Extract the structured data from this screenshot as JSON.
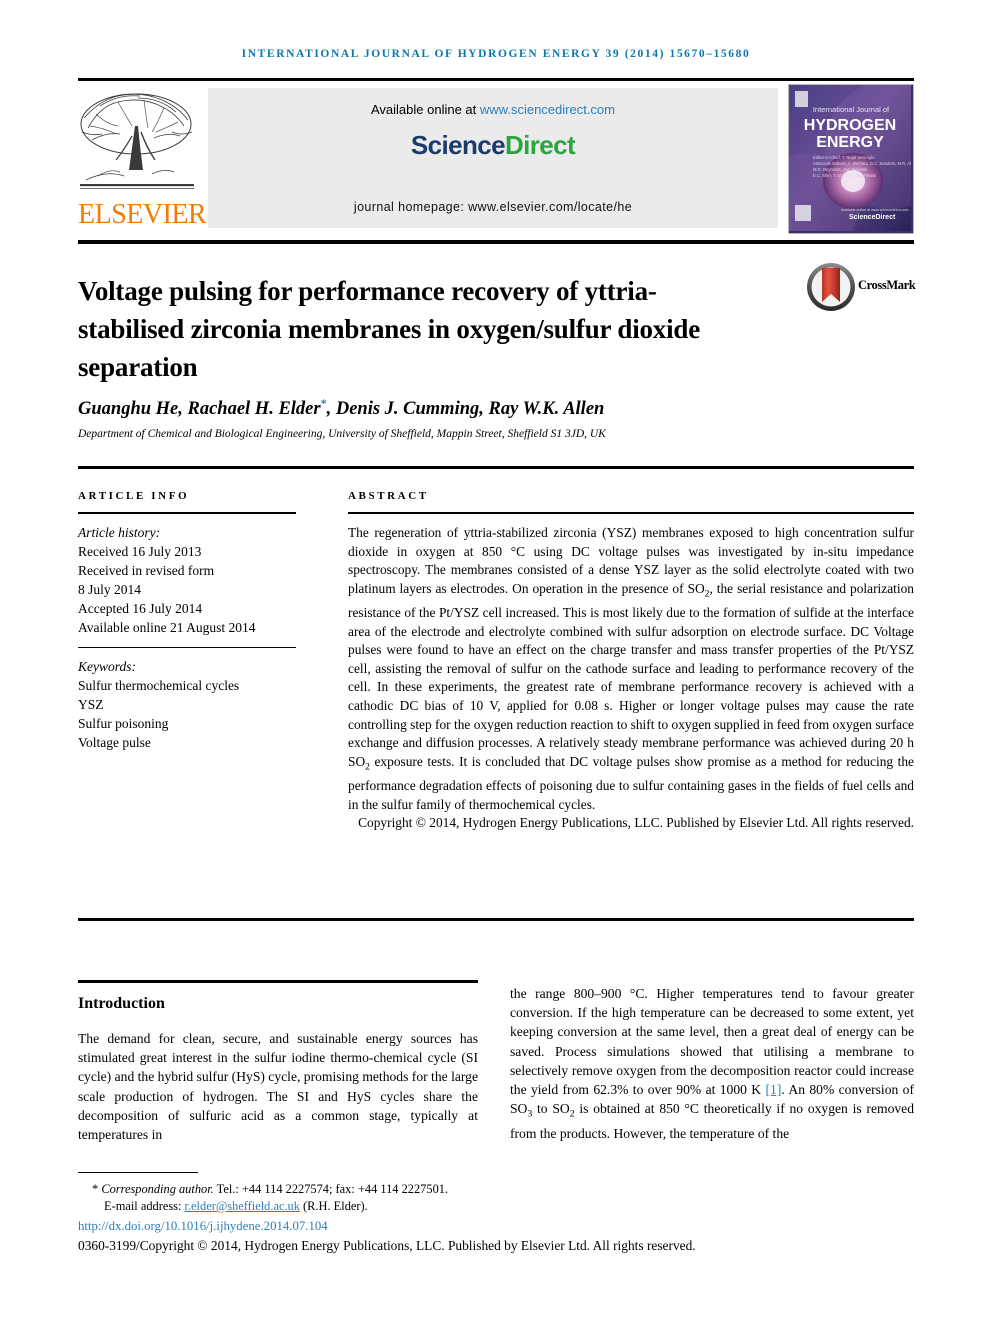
{
  "running_head": "International Journal of Hydrogen Energy 39 (2014) 15670–15680",
  "masthead": {
    "publisher_name": "ELSEVIER",
    "available_prefix": "Available online at ",
    "available_url": "www.sciencedirect.com",
    "sciencedirect_part1": "Science",
    "sciencedirect_part2": "Direct",
    "homepage": "journal homepage: www.elsevier.com/locate/he",
    "cover": {
      "line_small": "International Journal of",
      "line1": "HYDROGEN",
      "line2": "ENERGY",
      "footer_brand": "ScienceDirect"
    }
  },
  "article": {
    "title": "Voltage pulsing for performance recovery of yttria-stabilised zirconia membranes in oxygen/sulfur dioxide separation",
    "crossmark_label": "CrossMark",
    "authors": "Guanghu He, Rachael H. Elder",
    "authors_rest": ", Denis J. Cumming, Ray W.K. Allen",
    "corresponding_marker": "*",
    "affiliation": "Department of Chemical and Biological Engineering, University of Sheffield, Mappin Street, Sheffield S1 3JD, UK"
  },
  "info": {
    "heading": "ARTICLE INFO",
    "history_label": "Article history:",
    "history": [
      "Received 16 July 2013",
      "Received in revised form",
      "8 July 2014",
      "Accepted 16 July 2014",
      "Available online 21 August 2014"
    ],
    "keywords_label": "Keywords:",
    "keywords": [
      "Sulfur thermochemical cycles",
      "YSZ",
      "Sulfur poisoning",
      "Voltage pulse"
    ]
  },
  "abstract": {
    "heading": "ABSTRACT",
    "text": "The regeneration of yttria-stabilized zirconia (YSZ) membranes exposed to high concentration sulfur dioxide in oxygen at 850 °C using DC voltage pulses was investigated by in-situ impedance spectroscopy. The membranes consisted of a dense YSZ layer as the solid electrolyte coated with two platinum layers as electrodes. On operation in the presence of SO2, the serial resistance and polarization resistance of the Pt/YSZ cell increased. This is most likely due to the formation of sulfide at the interface area of the electrode and electrolyte combined with sulfur adsorption on electrode surface. DC Voltage pulses were found to have an effect on the charge transfer and mass transfer properties of the Pt/YSZ cell, assisting the removal of sulfur on the cathode surface and leading to performance recovery of the cell. In these experiments, the greatest rate of membrane performance recovery is achieved with a cathodic DC bias of 10 V, applied for 0.08 s. Higher or longer voltage pulses may cause the rate controlling step for the oxygen reduction reaction to shift to oxygen supplied in feed from oxygen surface exchange and diffusion processes. A relatively steady membrane performance was achieved during 20 h SO2 exposure tests. It is concluded that DC voltage pulses show promise as a method for reducing the performance degradation effects of poisoning due to sulfur containing gases in the fields of fuel cells and in the sulfur family of thermochemical cycles.",
    "copyright": "Copyright © 2014, Hydrogen Energy Publications, LLC. Published by Elsevier Ltd. All rights reserved."
  },
  "body": {
    "intro_heading": "Introduction",
    "intro_left": "The demand for clean, secure, and sustainable energy sources has stimulated great interest in the sulfur iodine thermo-chemical cycle (SI cycle) and the hybrid sulfur (HyS) cycle, promising methods for the large scale production of hydrogen. The SI and HyS cycles share the decomposition of sulfuric acid as a common stage, typically at temperatures in",
    "intro_right_a": "the range 800–900 °C. Higher temperatures tend to favour greater conversion. If the high temperature can be decreased to some extent, yet keeping conversion at the same level, then a great deal of energy can be saved. Process simulations showed that utilising a membrane to selectively remove oxygen from the decomposition reactor could increase the yield from 62.3% to over 90% at 1000 K ",
    "intro_right_ref": "[1]",
    "intro_right_b": ". An 80% conversion of SO3 to SO2 is obtained at 850 °C theoretically if no oxygen is removed from the products. However, the temperature of the"
  },
  "footnote": {
    "corresponding_label": "Corresponding author.",
    "contact": " Tel.: +44 114 2227574; fax: +44 114 2227501.",
    "email_label": "E-mail address: ",
    "email": "r.elder@sheffield.ac.uk",
    "email_owner": " (R.H. Elder).",
    "doi": "http://dx.doi.org/10.1016/j.ijhydene.2014.07.104",
    "issn_copyright": "0360-3199/Copyright © 2014, Hydrogen Energy Publications, LLC. Published by Elsevier Ltd. All rights reserved."
  },
  "colors": {
    "journal_blue": "#0b78a8",
    "link_blue": "#2b7fbd",
    "elsevier_orange": "#f07d00",
    "sciencedirect_green": "#2aa641",
    "sciencedirect_navy": "#1b3b6f"
  }
}
